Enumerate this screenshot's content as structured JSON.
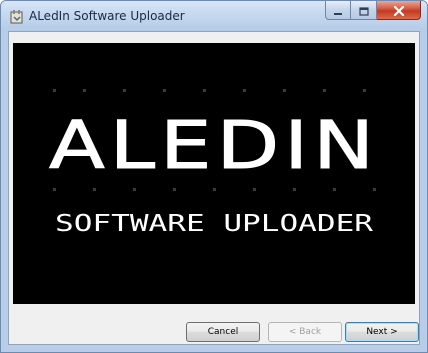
{
  "window": {
    "title": "ALedIn Software Uploader",
    "icon": "app-plugin-icon"
  },
  "caption_buttons": {
    "minimize_icon": "minimize-icon",
    "maximize_icon": "maximize-icon",
    "close_icon": "close-icon"
  },
  "banner": {
    "logo_title": "ALEDIN",
    "logo_subtitle": "SOFTWARE UPLOADER",
    "background": "#000000",
    "text_color": "#ffffff"
  },
  "buttons": {
    "cancel": "Cancel",
    "back": "< Back",
    "next": "Next >"
  }
}
